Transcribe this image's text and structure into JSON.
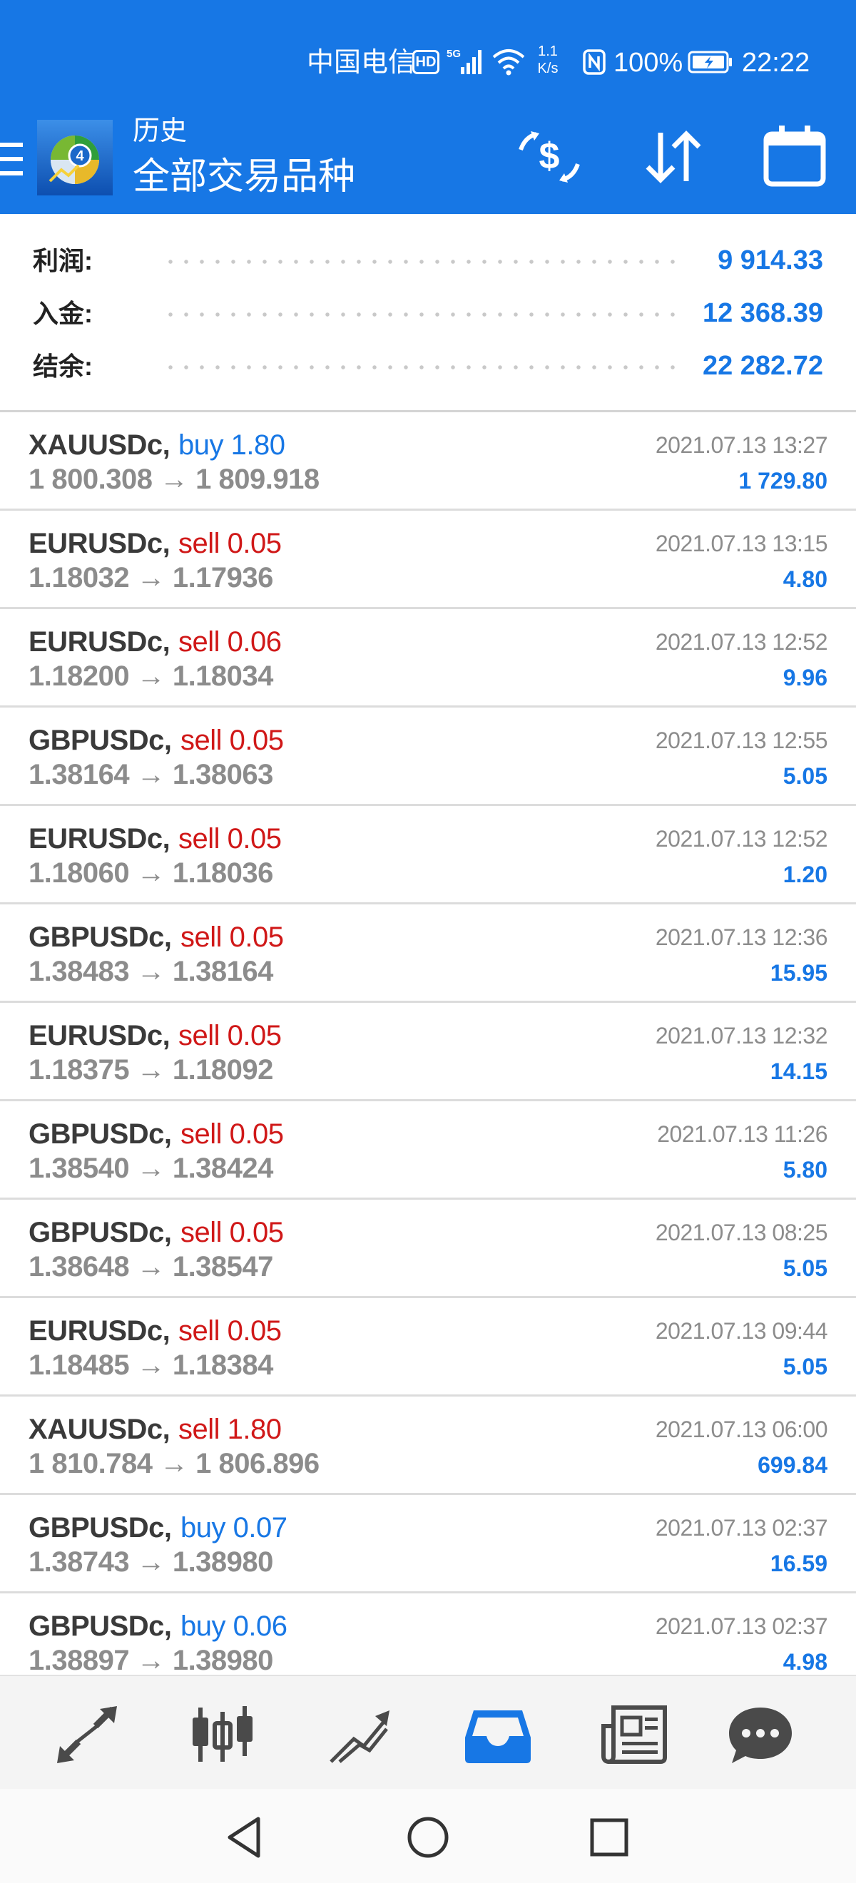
{
  "status_bar": {
    "carrier": "中国电信",
    "hd": "HD",
    "net_type": "5G",
    "speed_value": "1.1",
    "speed_unit": "K/s",
    "battery": "100%",
    "time": "22:22"
  },
  "app_bar": {
    "subtitle": "历史",
    "title": "全部交易品种"
  },
  "summary": {
    "profit_label": "利润:",
    "profit_value": "9 914.33",
    "deposit_label": "入金:",
    "deposit_value": "12 368.39",
    "balance_label": "结余:",
    "balance_value": "22 282.72"
  },
  "trades": [
    {
      "symbol": "XAUUSDc,",
      "side": "buy",
      "volume": "buy 1.80",
      "prices": "1 800.308 → 1 809.918",
      "time": "2021.07.13 13:27",
      "profit": "1 729.80"
    },
    {
      "symbol": "EURUSDc,",
      "side": "sell",
      "volume": "sell 0.05",
      "prices": "1.18032 → 1.17936",
      "time": "2021.07.13 13:15",
      "profit": "4.80"
    },
    {
      "symbol": "EURUSDc,",
      "side": "sell",
      "volume": "sell 0.06",
      "prices": "1.18200 → 1.18034",
      "time": "2021.07.13 12:52",
      "profit": "9.96"
    },
    {
      "symbol": "GBPUSDc,",
      "side": "sell",
      "volume": "sell 0.05",
      "prices": "1.38164 → 1.38063",
      "time": "2021.07.13 12:55",
      "profit": "5.05"
    },
    {
      "symbol": "EURUSDc,",
      "side": "sell",
      "volume": "sell 0.05",
      "prices": "1.18060 → 1.18036",
      "time": "2021.07.13 12:52",
      "profit": "1.20"
    },
    {
      "symbol": "GBPUSDc,",
      "side": "sell",
      "volume": "sell 0.05",
      "prices": "1.38483 → 1.38164",
      "time": "2021.07.13 12:36",
      "profit": "15.95"
    },
    {
      "symbol": "EURUSDc,",
      "side": "sell",
      "volume": "sell 0.05",
      "prices": "1.18375 → 1.18092",
      "time": "2021.07.13 12:32",
      "profit": "14.15"
    },
    {
      "symbol": "GBPUSDc,",
      "side": "sell",
      "volume": "sell 0.05",
      "prices": "1.38540 → 1.38424",
      "time": "2021.07.13 11:26",
      "profit": "5.80"
    },
    {
      "symbol": "GBPUSDc,",
      "side": "sell",
      "volume": "sell 0.05",
      "prices": "1.38648 → 1.38547",
      "time": "2021.07.13 08:25",
      "profit": "5.05"
    },
    {
      "symbol": "EURUSDc,",
      "side": "sell",
      "volume": "sell 0.05",
      "prices": "1.18485 → 1.18384",
      "time": "2021.07.13 09:44",
      "profit": "5.05"
    },
    {
      "symbol": "XAUUSDc,",
      "side": "sell",
      "volume": "sell 1.80",
      "prices": "1 810.784 → 1 806.896",
      "time": "2021.07.13 06:00",
      "profit": "699.84"
    },
    {
      "symbol": "GBPUSDc,",
      "side": "buy",
      "volume": "buy 0.07",
      "prices": "1.38743 → 1.38980",
      "time": "2021.07.13 02:37",
      "profit": "16.59"
    },
    {
      "symbol": "GBPUSDc,",
      "side": "buy",
      "volume": "buy 0.06",
      "prices": "1.38897 → 1.38980",
      "time": "2021.07.13 02:37",
      "profit": "4.98"
    }
  ],
  "bottom_nav": {
    "items": [
      {
        "icon": "quotes-arrows-icon"
      },
      {
        "icon": "candlestick-chart-icon"
      },
      {
        "icon": "trend-chart-icon"
      },
      {
        "icon": "history-inbox-icon",
        "active": true
      },
      {
        "icon": "news-icon"
      },
      {
        "icon": "chat-icon"
      }
    ]
  },
  "colors": {
    "brand_blue": "#1777e5",
    "sell_red": "#d01818",
    "muted_gray": "#8c8c8c",
    "nav_gray": "#4a4a4a"
  }
}
